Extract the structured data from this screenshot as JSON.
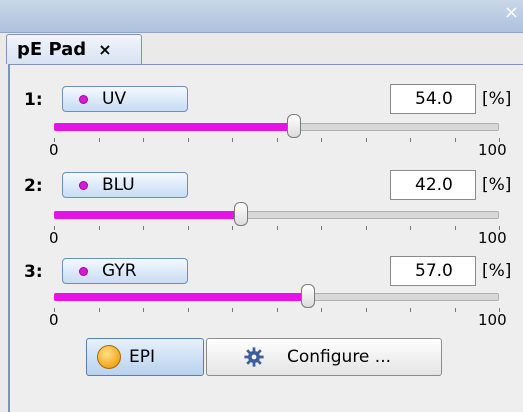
{
  "window": {
    "close_glyph": "×"
  },
  "tab": {
    "title": "pE Pad",
    "close_glyph": "×"
  },
  "channels": [
    {
      "index": "1:",
      "name": "UV",
      "value": "54.0",
      "unit": "[%]",
      "level_percent": 54.0,
      "min": "0",
      "max": "100",
      "dot_color": "#d81ad8"
    },
    {
      "index": "2:",
      "name": "BLU",
      "value": "42.0",
      "unit": "[%]",
      "level_percent": 42.0,
      "min": "0",
      "max": "100",
      "dot_color": "#d81ad8"
    },
    {
      "index": "3:",
      "name": "GYR",
      "value": "57.0",
      "unit": "[%]",
      "level_percent": 57.0,
      "min": "0",
      "max": "100",
      "dot_color": "#d81ad8"
    }
  ],
  "buttons": {
    "epi_label": "EPI",
    "configure_label": "Configure ...",
    "epi_icon": "orange-circle-icon",
    "configure_icon": "gear-icon"
  },
  "colors": {
    "slider_fill": "#e612e6",
    "accent": "#b8d2ee"
  }
}
